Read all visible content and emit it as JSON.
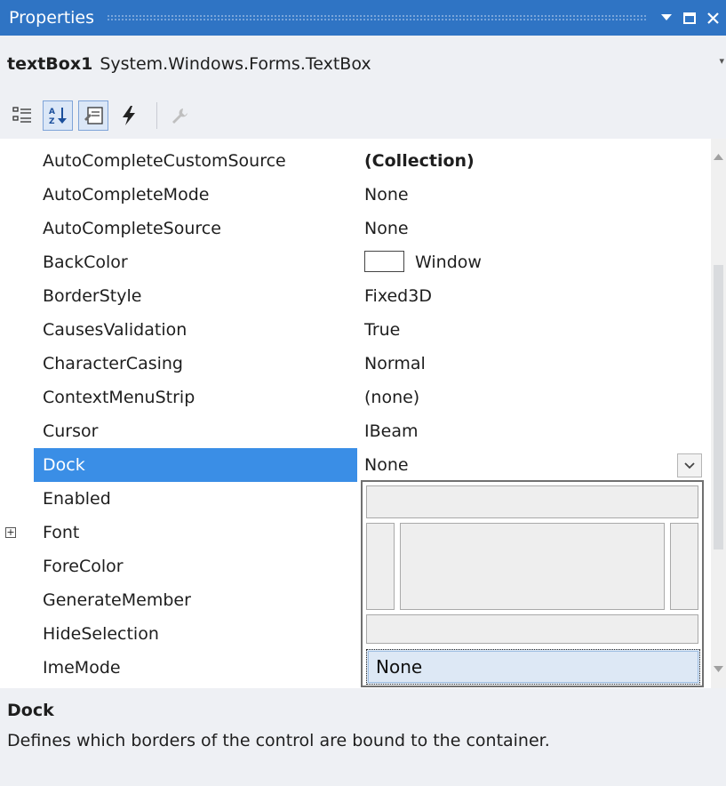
{
  "window": {
    "title": "Properties"
  },
  "object_selector": {
    "name": "textBox1",
    "type": "System.Windows.Forms.TextBox"
  },
  "toolbar": {
    "buttons": [
      {
        "icon": "categorized-icon",
        "active": false
      },
      {
        "icon": "alphabetical-sort-icon",
        "active": true
      },
      {
        "icon": "properties-icon",
        "active": true
      },
      {
        "icon": "events-lightning-icon",
        "active": false
      },
      {
        "icon": "property-pages-wrench-icon",
        "active": false
      }
    ]
  },
  "properties": [
    {
      "name": "AutoCompleteCustomSource",
      "value": "(Collection)",
      "bold": true
    },
    {
      "name": "AutoCompleteMode",
      "value": "None"
    },
    {
      "name": "AutoCompleteSource",
      "value": "None"
    },
    {
      "name": "BackColor",
      "value": "Window",
      "swatch": "#ffffff"
    },
    {
      "name": "BorderStyle",
      "value": "Fixed3D"
    },
    {
      "name": "CausesValidation",
      "value": "True"
    },
    {
      "name": "CharacterCasing",
      "value": "Normal"
    },
    {
      "name": "ContextMenuStrip",
      "value": "(none)"
    },
    {
      "name": "Cursor",
      "value": "IBeam"
    },
    {
      "name": "Dock",
      "value": "None",
      "selected": true
    },
    {
      "name": "Enabled",
      "value": ""
    },
    {
      "name": "Font",
      "value": "",
      "expandable": true,
      "expander": "+"
    },
    {
      "name": "ForeColor",
      "value": ""
    },
    {
      "name": "GenerateMember",
      "value": ""
    },
    {
      "name": "HideSelection",
      "value": ""
    },
    {
      "name": "ImeMode",
      "value": ""
    }
  ],
  "dock_editor": {
    "none_label": "None"
  },
  "description": {
    "title": "Dock",
    "text": "Defines which borders of the control are bound to the container."
  },
  "colors": {
    "titlebar": "#2f74c4",
    "selection": "#3a8ee6",
    "panel": "#eef0f4"
  }
}
